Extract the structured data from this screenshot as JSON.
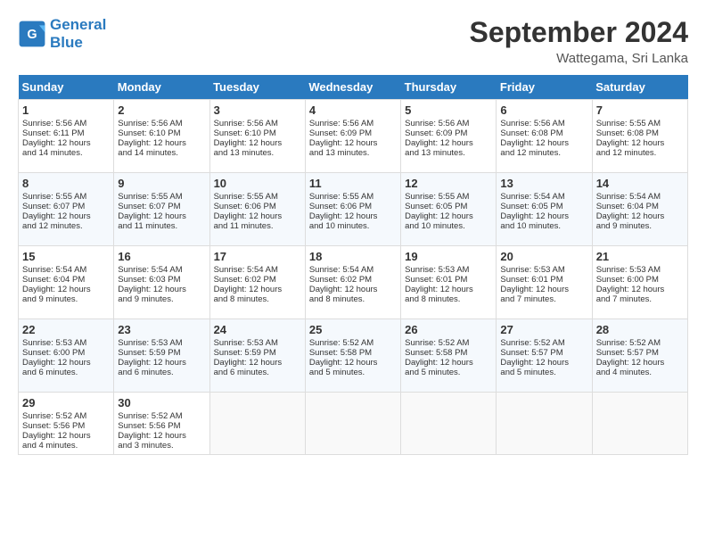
{
  "header": {
    "logo_line1": "General",
    "logo_line2": "Blue",
    "month": "September 2024",
    "location": "Wattegama, Sri Lanka"
  },
  "days_of_week": [
    "Sunday",
    "Monday",
    "Tuesday",
    "Wednesday",
    "Thursday",
    "Friday",
    "Saturday"
  ],
  "weeks": [
    [
      {
        "day": "1",
        "lines": [
          "Sunrise: 5:56 AM",
          "Sunset: 6:11 PM",
          "Daylight: 12 hours",
          "and 14 minutes."
        ]
      },
      {
        "day": "2",
        "lines": [
          "Sunrise: 5:56 AM",
          "Sunset: 6:10 PM",
          "Daylight: 12 hours",
          "and 14 minutes."
        ]
      },
      {
        "day": "3",
        "lines": [
          "Sunrise: 5:56 AM",
          "Sunset: 6:10 PM",
          "Daylight: 12 hours",
          "and 13 minutes."
        ]
      },
      {
        "day": "4",
        "lines": [
          "Sunrise: 5:56 AM",
          "Sunset: 6:09 PM",
          "Daylight: 12 hours",
          "and 13 minutes."
        ]
      },
      {
        "day": "5",
        "lines": [
          "Sunrise: 5:56 AM",
          "Sunset: 6:09 PM",
          "Daylight: 12 hours",
          "and 13 minutes."
        ]
      },
      {
        "day": "6",
        "lines": [
          "Sunrise: 5:56 AM",
          "Sunset: 6:08 PM",
          "Daylight: 12 hours",
          "and 12 minutes."
        ]
      },
      {
        "day": "7",
        "lines": [
          "Sunrise: 5:55 AM",
          "Sunset: 6:08 PM",
          "Daylight: 12 hours",
          "and 12 minutes."
        ]
      }
    ],
    [
      {
        "day": "8",
        "lines": [
          "Sunrise: 5:55 AM",
          "Sunset: 6:07 PM",
          "Daylight: 12 hours",
          "and 12 minutes."
        ]
      },
      {
        "day": "9",
        "lines": [
          "Sunrise: 5:55 AM",
          "Sunset: 6:07 PM",
          "Daylight: 12 hours",
          "and 11 minutes."
        ]
      },
      {
        "day": "10",
        "lines": [
          "Sunrise: 5:55 AM",
          "Sunset: 6:06 PM",
          "Daylight: 12 hours",
          "and 11 minutes."
        ]
      },
      {
        "day": "11",
        "lines": [
          "Sunrise: 5:55 AM",
          "Sunset: 6:06 PM",
          "Daylight: 12 hours",
          "and 10 minutes."
        ]
      },
      {
        "day": "12",
        "lines": [
          "Sunrise: 5:55 AM",
          "Sunset: 6:05 PM",
          "Daylight: 12 hours",
          "and 10 minutes."
        ]
      },
      {
        "day": "13",
        "lines": [
          "Sunrise: 5:54 AM",
          "Sunset: 6:05 PM",
          "Daylight: 12 hours",
          "and 10 minutes."
        ]
      },
      {
        "day": "14",
        "lines": [
          "Sunrise: 5:54 AM",
          "Sunset: 6:04 PM",
          "Daylight: 12 hours",
          "and 9 minutes."
        ]
      }
    ],
    [
      {
        "day": "15",
        "lines": [
          "Sunrise: 5:54 AM",
          "Sunset: 6:04 PM",
          "Daylight: 12 hours",
          "and 9 minutes."
        ]
      },
      {
        "day": "16",
        "lines": [
          "Sunrise: 5:54 AM",
          "Sunset: 6:03 PM",
          "Daylight: 12 hours",
          "and 9 minutes."
        ]
      },
      {
        "day": "17",
        "lines": [
          "Sunrise: 5:54 AM",
          "Sunset: 6:02 PM",
          "Daylight: 12 hours",
          "and 8 minutes."
        ]
      },
      {
        "day": "18",
        "lines": [
          "Sunrise: 5:54 AM",
          "Sunset: 6:02 PM",
          "Daylight: 12 hours",
          "and 8 minutes."
        ]
      },
      {
        "day": "19",
        "lines": [
          "Sunrise: 5:53 AM",
          "Sunset: 6:01 PM",
          "Daylight: 12 hours",
          "and 8 minutes."
        ]
      },
      {
        "day": "20",
        "lines": [
          "Sunrise: 5:53 AM",
          "Sunset: 6:01 PM",
          "Daylight: 12 hours",
          "and 7 minutes."
        ]
      },
      {
        "day": "21",
        "lines": [
          "Sunrise: 5:53 AM",
          "Sunset: 6:00 PM",
          "Daylight: 12 hours",
          "and 7 minutes."
        ]
      }
    ],
    [
      {
        "day": "22",
        "lines": [
          "Sunrise: 5:53 AM",
          "Sunset: 6:00 PM",
          "Daylight: 12 hours",
          "and 6 minutes."
        ]
      },
      {
        "day": "23",
        "lines": [
          "Sunrise: 5:53 AM",
          "Sunset: 5:59 PM",
          "Daylight: 12 hours",
          "and 6 minutes."
        ]
      },
      {
        "day": "24",
        "lines": [
          "Sunrise: 5:53 AM",
          "Sunset: 5:59 PM",
          "Daylight: 12 hours",
          "and 6 minutes."
        ]
      },
      {
        "day": "25",
        "lines": [
          "Sunrise: 5:52 AM",
          "Sunset: 5:58 PM",
          "Daylight: 12 hours",
          "and 5 minutes."
        ]
      },
      {
        "day": "26",
        "lines": [
          "Sunrise: 5:52 AM",
          "Sunset: 5:58 PM",
          "Daylight: 12 hours",
          "and 5 minutes."
        ]
      },
      {
        "day": "27",
        "lines": [
          "Sunrise: 5:52 AM",
          "Sunset: 5:57 PM",
          "Daylight: 12 hours",
          "and 5 minutes."
        ]
      },
      {
        "day": "28",
        "lines": [
          "Sunrise: 5:52 AM",
          "Sunset: 5:57 PM",
          "Daylight: 12 hours",
          "and 4 minutes."
        ]
      }
    ],
    [
      {
        "day": "29",
        "lines": [
          "Sunrise: 5:52 AM",
          "Sunset: 5:56 PM",
          "Daylight: 12 hours",
          "and 4 minutes."
        ]
      },
      {
        "day": "30",
        "lines": [
          "Sunrise: 5:52 AM",
          "Sunset: 5:56 PM",
          "Daylight: 12 hours",
          "and 3 minutes."
        ]
      },
      {
        "day": "",
        "lines": []
      },
      {
        "day": "",
        "lines": []
      },
      {
        "day": "",
        "lines": []
      },
      {
        "day": "",
        "lines": []
      },
      {
        "day": "",
        "lines": []
      }
    ]
  ]
}
